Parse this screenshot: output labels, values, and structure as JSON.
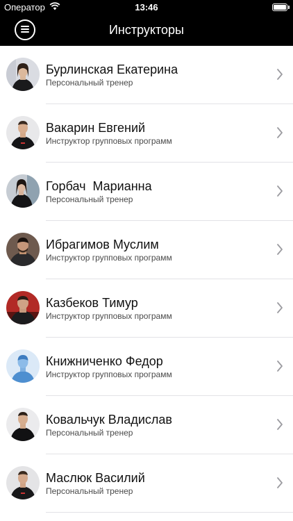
{
  "status_bar": {
    "carrier": "Оператор",
    "time": "13:46",
    "wifi_icon": "wifi-icon",
    "battery_icon": "battery-icon"
  },
  "nav": {
    "title": "Инструкторы",
    "menu_icon": "hamburger-menu-icon"
  },
  "colors": {
    "bar_background": "#000000",
    "list_background": "#ffffff",
    "separator": "#e2e2e6",
    "chevron": "#9b9ba0"
  },
  "instructors": [
    {
      "name": "Бурлинская Екатерина",
      "role": "Персональный тренер"
    },
    {
      "name": "Вакарин Евгений",
      "role": "Инструктор групповых программ"
    },
    {
      "name": "Горбач  Марианна",
      "role": "Персональный тренер"
    },
    {
      "name": "Ибрагимов Муслим",
      "role": "Инструктор групповых программ"
    },
    {
      "name": "Казбеков Тимур",
      "role": "Инструктор групповых программ"
    },
    {
      "name": "Книжниченко Федор",
      "role": "Инструктор групповых программ"
    },
    {
      "name": "Ковальчук Владислав",
      "role": "Персональный тренер"
    },
    {
      "name": "Маслюк Василий",
      "role": "Персональный тренер"
    }
  ]
}
